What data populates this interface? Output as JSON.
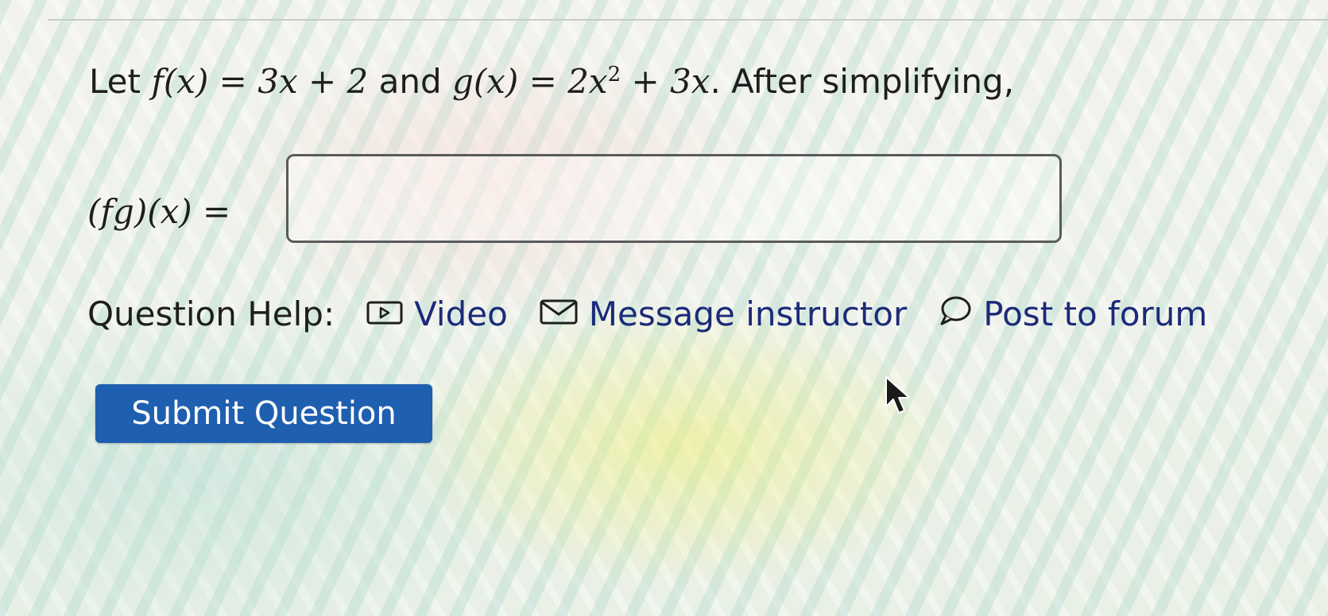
{
  "question": {
    "prefix": "Let ",
    "f_def": "f(x) = 3x + 2",
    "conj": " and ",
    "g_def_base": "g(x) = 2x",
    "g_def_exp": "2",
    "g_def_tail": " + 3x",
    "suffix": ". After simplifying,"
  },
  "answer": {
    "label": "(fg)(x) =",
    "value": "",
    "placeholder": ""
  },
  "help": {
    "label": "Question Help:",
    "links": [
      {
        "label": "Video",
        "icon": "video-icon"
      },
      {
        "label": "Message instructor",
        "icon": "mail-icon"
      },
      {
        "label": "Post to forum",
        "icon": "chat-bubble-icon"
      }
    ]
  },
  "submit": {
    "label": "Submit Question"
  },
  "colors": {
    "submit_bg": "#1f5fb0",
    "link": "#1c2a7a",
    "text": "#1e1e1e"
  }
}
